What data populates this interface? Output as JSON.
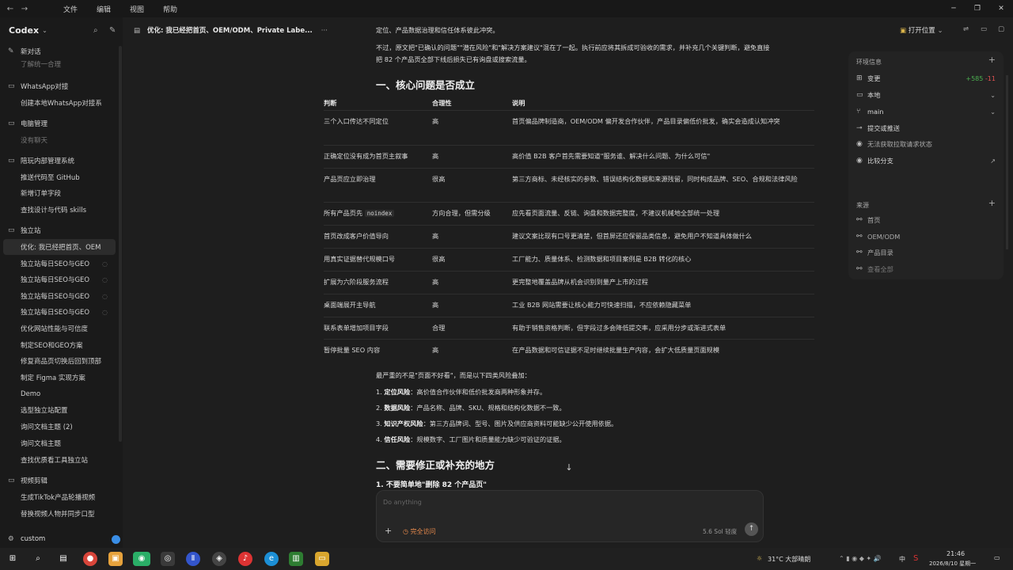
{
  "menubar": {
    "items": [
      "文件",
      "编辑",
      "视图",
      "帮助"
    ]
  },
  "sidebar": {
    "app_name": "Codex",
    "new_thread": "新对话",
    "sections": [
      {
        "label": "WhatsApp对接",
        "items": [
          "创建本地WhatsApp对接系"
        ]
      },
      {
        "label": "电脑管理",
        "items": [
          "没有聊天"
        ]
      },
      {
        "label": "陪玩内部管理系统",
        "items": [
          "推送代码至 GitHub",
          "新增订单字段",
          "查找设计与代码 skills"
        ]
      },
      {
        "label": "独立站",
        "items": [
          "优化: 我已经把首页、OEM",
          "独立站每日SEO与GEO",
          "独立站每日SEO与GEO",
          "独立站每日SEO与GEO",
          "独立站每日SEO与GEO",
          "优化网站性能与可信度",
          "制定SEO和GEO方案",
          "修复商品页切换后回到顶部",
          "制定 Figma 实现方案",
          "Demo",
          "选型独立站配置",
          "询问文档主题 (2)",
          "询问文档主题",
          "查找优质看工具独立站"
        ]
      },
      {
        "label": "视频剪辑",
        "items": [
          "生成TikTok产品轮播视频",
          "替换视频人物并同步口型"
        ]
      }
    ],
    "top_partial": "了解统一合理",
    "footer": "custom"
  },
  "main": {
    "tab_title": "优化: 我已经把首页、OEM/ODM、Private Labe...",
    "open_location": "打开位置",
    "para_top_partial": "定位、产品数据治理和信任体系彼此冲突。",
    "para2": "不过，原文把\"已确认的问题\"\"潜在风险\"和\"解决方案建议\"混在了一起。执行前应将其拆成可验收的需求，并补充几个关键判断，避免直接把 82 个产品页全部下线后损失已有询盘或搜索流量。",
    "section1_title": "一、核心问题是否成立",
    "table": {
      "headers": [
        "判断",
        "合理性",
        "说明"
      ],
      "rows": [
        {
          "judgment": "三个入口传达不同定位",
          "reasonable": "高",
          "note": "首页偏品牌制造商，OEM/ODM 偏开发合作伙伴，产品目录偏低价批发，确实会造成认知冲突"
        },
        {
          "judgment": "正确定位没有成为首页主叙事",
          "reasonable": "高",
          "note": "高价值 B2B 客户首先需要知道\"服务谁、解决什么问题、为什么可信\""
        },
        {
          "judgment": "产品页应立即治理",
          "reasonable": "很高",
          "note": "第三方商标、未经核实的参数、错误结构化数据和来源残留，同时构成品牌、SEO、合规和法律风险"
        },
        {
          "judgment": "所有产品页先 ",
          "judgment_code": "noindex",
          "reasonable": "方向合理，但需分级",
          "note": "应先看页面流量、反链、询盘和数据完整度，不建议机械地全部统一处理"
        },
        {
          "judgment": "首页改成客户价值导向",
          "reasonable": "高",
          "note": "建议文案比现有口号更清楚，但首屏还应保留品类信息，避免用户不知道具体做什么"
        },
        {
          "judgment": "用真实证据替代规模口号",
          "reasonable": "很高",
          "note": "工厂能力、质量体系、检测数据和项目案例是 B2B 转化的核心"
        },
        {
          "judgment": "扩展为六阶段服务流程",
          "reasonable": "高",
          "note": "更完整地覆盖品牌从机会识别到量产上市的过程"
        },
        {
          "judgment": "桌面端展开主导航",
          "reasonable": "高",
          "note": "工业 B2B 网站需要让核心能力可快速扫描，不应依赖隐藏菜单"
        },
        {
          "judgment": "联系表单增加项目字段",
          "reasonable": "合理",
          "note": "有助于销售资格判断，但字段过多会降低提交率，应采用分步或渐进式表单"
        },
        {
          "judgment": "暂停批量 SEO 内容",
          "reasonable": "高",
          "note": "在产品数据和可信证据不足时继续批量生产内容，会扩大低质量页面规模"
        }
      ]
    },
    "summary": "最严重的不是\"页面不好看\"，而是以下四类风险叠加：",
    "risks": [
      {
        "title": "定位风险",
        "text": "：高价值合作伙伴和低价批发商两种形象并存。"
      },
      {
        "title": "数据风险",
        "text": "：产品名称、品牌、SKU、规格和结构化数据不一致。"
      },
      {
        "title": "知识产权风险",
        "text": "：第三方品牌词、型号、图片及供应商资料可能缺少公开使用依据。"
      },
      {
        "title": "信任风险",
        "text": "：规模数字、工厂图片和质量能力缺少可验证的证据。"
      }
    ],
    "section2_title": "二、需要修正或补充的地方",
    "section2_partial": "1. 不要简单地\"删除 82 个产品页\"",
    "composer": {
      "placeholder": "Do anything",
      "access": "完全访问",
      "model": "5.6 Sol",
      "effort": "轻度"
    }
  },
  "right_panel": {
    "env_title": "环境信息",
    "changes_label": "变更",
    "additions": "+585",
    "deletions": "-11",
    "local_label": "本地",
    "branch_label": "main",
    "commit_push": "提交或推送",
    "pr_status": "无法获取拉取请求状态",
    "compare_branch": "比较分支",
    "sources_title": "来源",
    "sources": [
      "首页",
      "OEM/ODM",
      "产品目录"
    ],
    "view_all": "查看全部"
  },
  "taskbar": {
    "weather": "31°C 大部晴朗",
    "ime_mid": "中",
    "time": "21:46",
    "date": "2026/8/10 星期一"
  }
}
